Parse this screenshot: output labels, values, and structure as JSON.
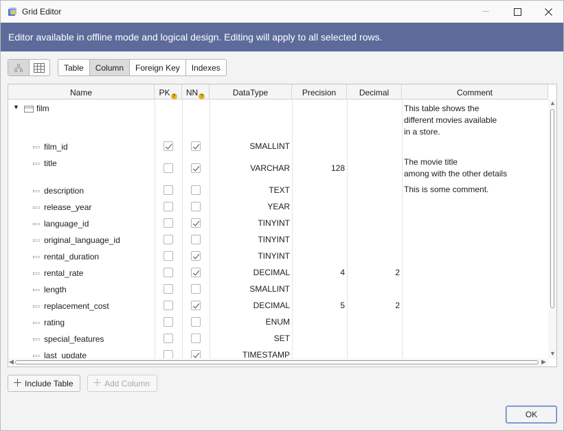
{
  "window": {
    "title": "Grid Editor"
  },
  "banner": {
    "text": "Editor available in offline mode and logical design. Editing will apply to all selected rows."
  },
  "tabs": [
    {
      "label": "Table",
      "active": false
    },
    {
      "label": "Column",
      "active": true
    },
    {
      "label": "Foreign Key",
      "active": false
    },
    {
      "label": "Indexes",
      "active": false
    }
  ],
  "grid": {
    "columns": {
      "name": "Name",
      "pk": "PK",
      "nn": "NN",
      "datatype": "DataType",
      "precision": "Precision",
      "decimal": "Decimal",
      "comment": "Comment"
    },
    "table": {
      "name": "film",
      "comment": "This table shows the\ndifferent movies available\nin a store."
    },
    "rows": [
      {
        "name": "film_id",
        "pk": true,
        "nn": true,
        "datatype": "SMALLINT",
        "precision": "",
        "decimal": "",
        "comment": ""
      },
      {
        "name": "title",
        "pk": false,
        "nn": true,
        "datatype": "VARCHAR",
        "precision": "128",
        "decimal": "",
        "comment": "The movie title\namong with the other details"
      },
      {
        "name": "description",
        "pk": false,
        "nn": false,
        "datatype": "TEXT",
        "precision": "",
        "decimal": "",
        "comment": "This is some comment."
      },
      {
        "name": "release_year",
        "pk": false,
        "nn": false,
        "datatype": "YEAR",
        "precision": "",
        "decimal": "",
        "comment": ""
      },
      {
        "name": "language_id",
        "pk": false,
        "nn": true,
        "datatype": "TINYINT",
        "precision": "",
        "decimal": "",
        "comment": ""
      },
      {
        "name": "original_language_id",
        "pk": false,
        "nn": false,
        "datatype": "TINYINT",
        "precision": "",
        "decimal": "",
        "comment": ""
      },
      {
        "name": "rental_duration",
        "pk": false,
        "nn": true,
        "datatype": "TINYINT",
        "precision": "",
        "decimal": "",
        "comment": ""
      },
      {
        "name": "rental_rate",
        "pk": false,
        "nn": true,
        "datatype": "DECIMAL",
        "precision": "4",
        "decimal": "2",
        "comment": ""
      },
      {
        "name": "length",
        "pk": false,
        "nn": false,
        "datatype": "SMALLINT",
        "precision": "",
        "decimal": "",
        "comment": ""
      },
      {
        "name": "replacement_cost",
        "pk": false,
        "nn": true,
        "datatype": "DECIMAL",
        "precision": "5",
        "decimal": "2",
        "comment": ""
      },
      {
        "name": "rating",
        "pk": false,
        "nn": false,
        "datatype": "ENUM",
        "precision": "",
        "decimal": "",
        "comment": ""
      },
      {
        "name": "special_features",
        "pk": false,
        "nn": false,
        "datatype": "SET",
        "precision": "",
        "decimal": "",
        "comment": ""
      },
      {
        "name": "last_update",
        "pk": false,
        "nn": true,
        "datatype": "TIMESTAMP",
        "precision": "",
        "decimal": "",
        "comment": ""
      }
    ]
  },
  "buttons": {
    "include_table": "Include Table",
    "add_column": "Add Column",
    "ok": "OK"
  },
  "icons": {
    "app": "grid-editor-app-icon",
    "tree_view": "tree-view-icon",
    "grid_view": "grid-view-icon",
    "table": "table-icon",
    "column": "column-icon",
    "help": "help-icon",
    "plus": "plus-icon"
  },
  "colors": {
    "banner_bg": "#5c6b9a",
    "banner_text": "#ffffff",
    "ok_border": "#5b7fc6",
    "help_badge": "#e6b62f"
  }
}
